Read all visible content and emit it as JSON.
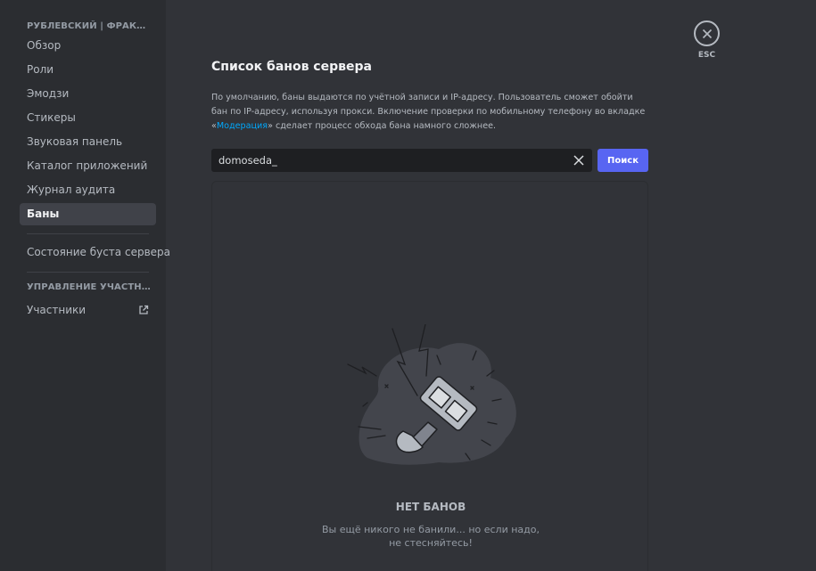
{
  "sidebar": {
    "server_header": "РУБЛЕВСКИЙ | ФРАКЦИИ",
    "items": [
      {
        "label": "Обзор"
      },
      {
        "label": "Роли"
      },
      {
        "label": "Эмодзи"
      },
      {
        "label": "Стикеры"
      },
      {
        "label": "Звуковая панель"
      },
      {
        "label": "Каталог приложений"
      },
      {
        "label": "Журнал аудита"
      },
      {
        "label": "Баны",
        "active": true
      }
    ],
    "boost_item": "Состояние буста сервера",
    "members_header": "УПРАВЛЕНИЕ УЧАСТНИКА...",
    "members_item": "Участники",
    "members_item_icon": "external-link-icon"
  },
  "main": {
    "title": "Список банов сервера",
    "description_before": "По умолчанию, баны выдаются по учётной записи и IP-адресу. Пользователь сможет обойти бан по IP-адресу, используя прокси. Включение проверки по мобильному телефону во вкладке «",
    "description_link": "Модерация",
    "description_after": "» сделает процесс обхода бана намного сложнее.",
    "search": {
      "value": "domoseda_",
      "placeholder": "",
      "clear_icon": "close-icon"
    },
    "search_button": "Поиск",
    "empty_state": {
      "title": "НЕТ БАНОВ",
      "line1": "Вы ещё никого не банили... но если надо,",
      "line2": "не стесняйтесь!",
      "illustration": "ban-hammer-illustration"
    }
  },
  "close": {
    "label": "ESC",
    "icon": "close-icon"
  },
  "colors": {
    "accent": "#5865f2",
    "link": "#00a8fc",
    "bg": "#313338",
    "sidebar_bg": "#2b2d31"
  }
}
